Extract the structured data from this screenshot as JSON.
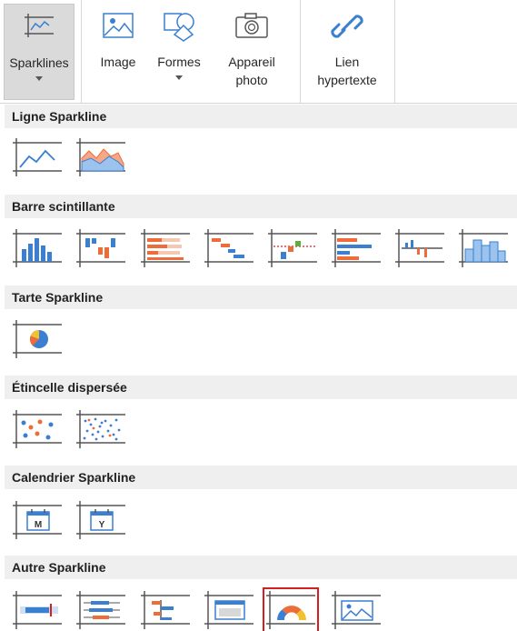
{
  "ribbon": {
    "buttons": [
      {
        "id": "sparklines",
        "label": "Sparklines",
        "icon": "sparkline-icon",
        "has_dropdown": true,
        "active": true
      },
      {
        "id": "image",
        "label": "Image",
        "icon": "image-icon",
        "has_dropdown": false
      },
      {
        "id": "formes",
        "label": "Formes",
        "icon": "shapes-icon",
        "has_dropdown": true
      },
      {
        "id": "appareil",
        "label": "Appareil photo",
        "label_line1": "Appareil",
        "label_line2": "photo",
        "icon": "camera-icon",
        "has_dropdown": false
      },
      {
        "id": "lien",
        "label": "Lien hypertexte",
        "label_line1": "Lien",
        "label_line2": "hypertexte",
        "icon": "link-icon",
        "has_dropdown": false
      }
    ]
  },
  "gallery": {
    "sections": [
      {
        "title": "Ligne Sparkline",
        "items": [
          "line-sparkline-icon",
          "area-sparkline-icon"
        ]
      },
      {
        "title": "Barre scintillante",
        "items": [
          "column-sparkline-icon",
          "winloss-sparkline-icon",
          "stacked-bar-sparkline-icon",
          "cascade-sparkline-icon",
          "variance-sparkline-icon",
          "hbar-sparkline-icon",
          "vertical-variance-sparkline-icon",
          "histogram-sparkline-icon"
        ]
      },
      {
        "title": "Tarte Sparkline",
        "items": [
          "pie-sparkline-icon"
        ]
      },
      {
        "title": "Étincelle dispersée",
        "items": [
          "scatter-sparkline-icon",
          "dense-scatter-sparkline-icon"
        ]
      },
      {
        "title": "Calendrier Sparkline",
        "items": [
          "month-calendar-sparkline-icon",
          "year-calendar-sparkline-icon"
        ]
      },
      {
        "title": "Autre Sparkline",
        "items": [
          "bullet-sparkline-icon",
          "box-plot-sparkline-icon",
          "spread-sparkline-icon",
          "image-sparkline-icon",
          "gauge-sparkline-icon",
          "picture-sparkline-icon"
        ]
      }
    ],
    "calendar_month_letter": "M",
    "calendar_year_letter": "Y",
    "selected_item": "gauge-sparkline-icon",
    "colors": {
      "accent_blue": "#3a7fd0",
      "accent_orange": "#ee6b3a",
      "light_orange": "#f5a887",
      "yellow": "#f2c12e",
      "green": "#5cae3e",
      "red_select": "#d62020",
      "frame": "#555555"
    }
  }
}
